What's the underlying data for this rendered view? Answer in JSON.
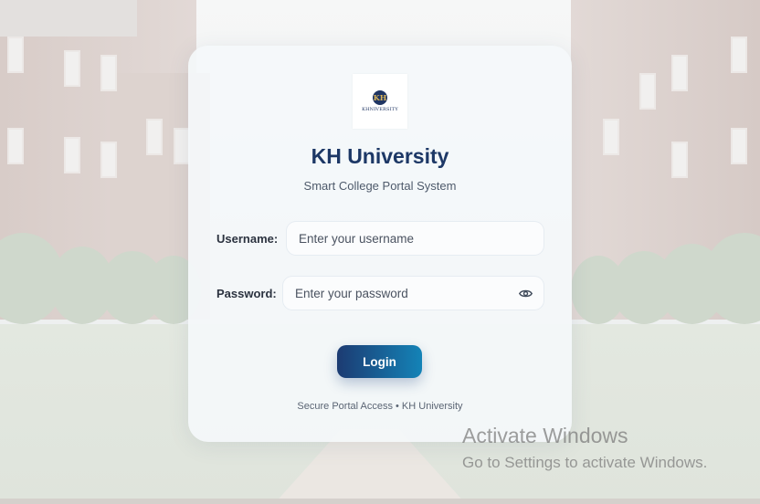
{
  "app": {
    "logo_text": "KHNIVERSITY",
    "logo_monogram": "KH",
    "title": "KH University",
    "subtitle": "Smart College Portal System"
  },
  "form": {
    "username_label": "Username:",
    "username_placeholder": "Enter your username",
    "username_value": "",
    "password_label": "Password:",
    "password_placeholder": "Enter your password",
    "password_value": "",
    "toggle_icon": "eye-icon",
    "login_label": "Login"
  },
  "footer": {
    "text": "Secure Portal Access • KH University"
  },
  "watermark": {
    "title": "Activate Windows",
    "subtitle": "Go to Settings to activate Windows."
  },
  "colors": {
    "title": "#1d3866",
    "button_start": "#1c3b72",
    "button_end": "#1483b7"
  }
}
